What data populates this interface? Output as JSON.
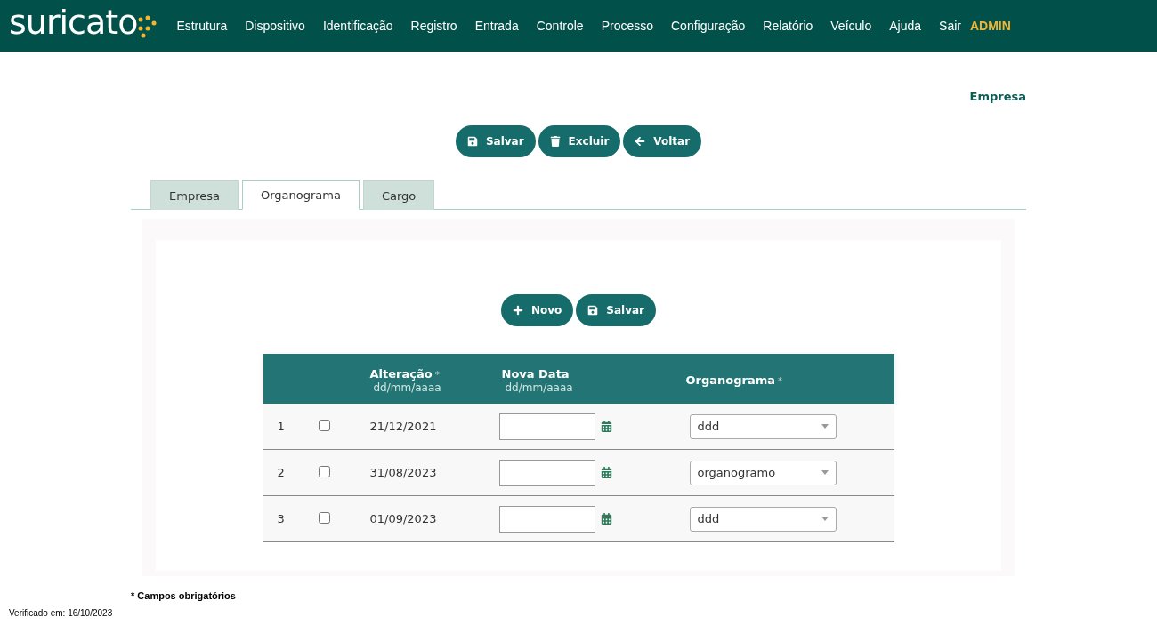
{
  "logo": {
    "text": "suricato"
  },
  "nav": [
    {
      "label": "Estrutura",
      "kind": "link"
    },
    {
      "label": "Dispositivo",
      "kind": "link"
    },
    {
      "label": "Identificação",
      "kind": "link"
    },
    {
      "label": "Registro",
      "kind": "link"
    },
    {
      "label": "Entrada",
      "kind": "link"
    },
    {
      "label": "Controle",
      "kind": "link"
    },
    {
      "label": "Processo",
      "kind": "link"
    },
    {
      "label": "Configuração",
      "kind": "link"
    },
    {
      "label": "Relatório",
      "kind": "link"
    },
    {
      "label": "Veículo",
      "kind": "link"
    },
    {
      "label": "Ajuda",
      "kind": "link"
    },
    {
      "label": "Sair",
      "kind": "link"
    },
    {
      "label": "ADMIN",
      "kind": "user"
    }
  ],
  "page_title": "Empresa",
  "actions": [
    {
      "label": "Salvar",
      "kind": "save"
    },
    {
      "label": "Excluir",
      "kind": "delete"
    },
    {
      "label": "Voltar",
      "kind": "back"
    }
  ],
  "tabs": [
    {
      "label": "Empresa",
      "selected": false
    },
    {
      "label": "Organograma",
      "selected": true
    },
    {
      "label": "Cargo",
      "selected": false
    }
  ],
  "panel_actions": [
    {
      "label": "Novo",
      "kind": "new"
    },
    {
      "label": "Salvar",
      "kind": "save"
    }
  ],
  "table": {
    "columns": [
      {
        "label": "Alteração",
        "required": "*",
        "hint": "dd/mm/aaaa"
      },
      {
        "label": "Nova Data",
        "hint": "dd/mm/aaaa"
      },
      {
        "label": "Organograma",
        "required": "*"
      }
    ],
    "rows": [
      {
        "index": "1",
        "checked": false,
        "date": "21/12/2021",
        "organograma": "ddd"
      },
      {
        "index": "2",
        "checked": false,
        "date": "31/08/2023",
        "organograma": "organogramo"
      },
      {
        "index": "3",
        "checked": false,
        "date": "01/09/2023",
        "organograma": "ddd"
      }
    ]
  },
  "required_note": "* Campos obrigatórios",
  "verified": "Verificado em: 16/10/2023"
}
